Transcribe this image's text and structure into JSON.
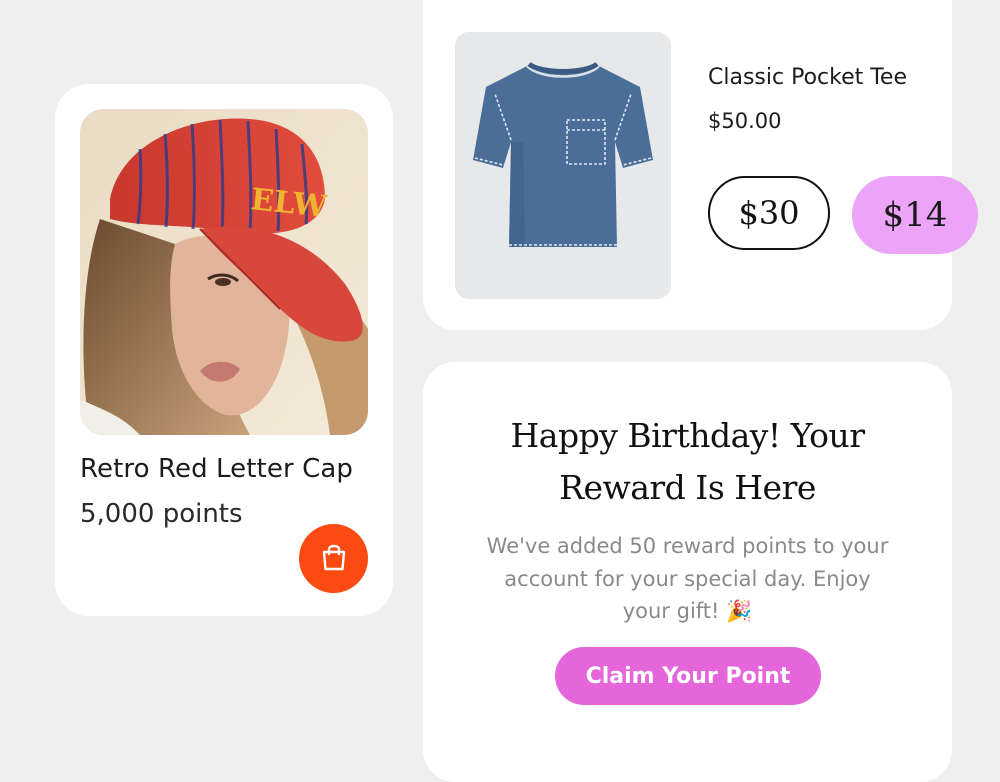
{
  "reward_product": {
    "image_alt": "photo-of-woman-in-red-cap",
    "title": "Retro Red Letter Cap",
    "points": "5,000 points",
    "cart_icon": "shopping-bag-icon",
    "accent_color": "#fb4a12"
  },
  "featured_product": {
    "title": "Classic Pocket Tee",
    "price": "$50.00",
    "price_options": [
      "$30",
      "$14"
    ],
    "selected_color": "#eba4f7"
  },
  "birthday": {
    "heading_lines": [
      "Happy Birthday! Your",
      "Reward Is Here"
    ],
    "body_lines": [
      "We've added 50 reward points to your",
      "account for your special day. Enjoy",
      "your gift! 🎉"
    ],
    "cta_label": "Claim Your Point",
    "cta_color": "#e565da"
  }
}
